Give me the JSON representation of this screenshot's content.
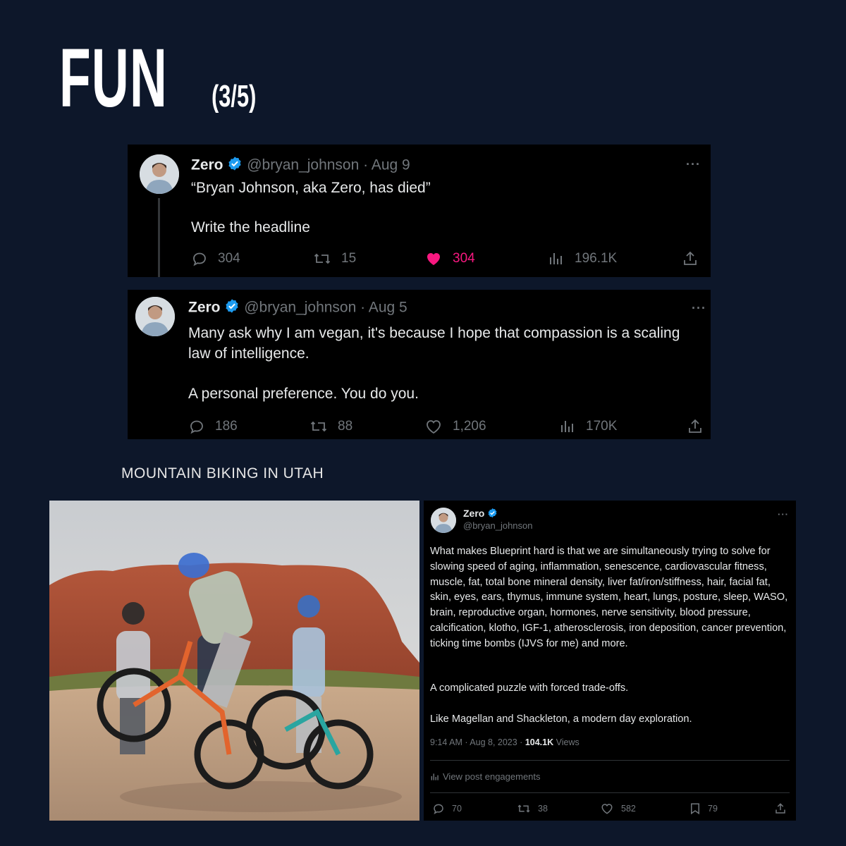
{
  "header": {
    "title": "FUN",
    "subtitle": "(3/5)"
  },
  "tweet1": {
    "name": "Zero",
    "handle": "@bryan_johnson",
    "date": "· Aug 9",
    "line1": "“Bryan Johnson, aka Zero, has died”",
    "line2": "Write the headline",
    "replies": "304",
    "retweets": "15",
    "likes": "304",
    "views": "196.1K"
  },
  "tweet2": {
    "name": "Zero",
    "handle": "@bryan_johnson",
    "date": "· Aug 5",
    "line1": "Many ask why I am vegan, it's because I hope that compassion is a scaling",
    "line2": "law of intelligence.",
    "line3": "A personal preference. You do you.",
    "replies": "186",
    "retweets": "88",
    "likes": "1,206",
    "views": "170K"
  },
  "section": {
    "label": "MOUNTAIN BIKING IN UTAH"
  },
  "tweet3": {
    "name": "Zero",
    "handle": "@bryan_johnson",
    "paragraph1": "What makes Blueprint hard is that we are simultaneously trying to solve for slowing speed of aging, inflammation, senescence, cardiovascular fitness, muscle, fat, total bone mineral density, liver fat/iron/stiffness, hair, facial fat, skin, eyes, ears, thymus, immune system, heart, lungs, posture, sleep, WASO, brain, reproductive organ, hormones, nerve sensitivity, blood pressure, calcification, klotho, IGF-1, atherosclerosis, iron deposition, cancer prevention, ticking time bombs (IJVS for me) and more.",
    "paragraph2": "A complicated puzzle with forced trade-offs.",
    "paragraph3": "Like Magellan and Shackleton, a modern day exploration.",
    "timestamp": "9:14 AM · Aug 8, 2023 · ",
    "views_count": "104.1K",
    "views_label": " Views",
    "engagements": "View post engagements",
    "replies": "70",
    "retweets": "38",
    "likes": "582",
    "bookmarks": "79"
  },
  "colors": {
    "background": "#0d172a",
    "tweet_bg": "#000000",
    "like": "#f91880",
    "verified": "#1d9bf0",
    "muted": "#71767b"
  }
}
